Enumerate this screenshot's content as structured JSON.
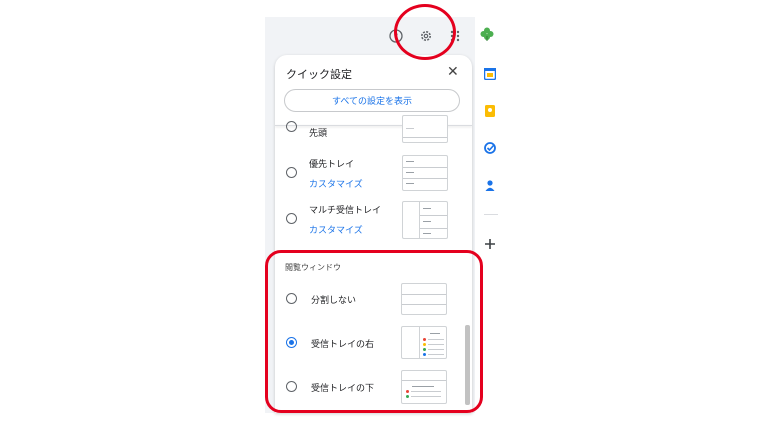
{
  "quick_settings": {
    "title": "クイック設定",
    "close_label": "✕",
    "all_settings_button": "すべての設定を表示"
  },
  "inbox_types": [
    {
      "label": "先頭",
      "selected": false
    },
    {
      "label": "優先トレイ",
      "link": "カスタマイズ",
      "selected": false
    },
    {
      "label": "マルチ受信トレイ",
      "link": "カスタマイズ",
      "selected": false
    }
  ],
  "reading_pane": {
    "heading": "閲覧ウィンドウ",
    "options": [
      {
        "label": "分割しない",
        "selected": false
      },
      {
        "label": "受信トレイの右",
        "selected": true
      },
      {
        "label": "受信トレイの下",
        "selected": false
      }
    ]
  },
  "header_icons": [
    "help-icon",
    "settings-gear-icon",
    "apps-grid-icon",
    "clover-avatar-icon"
  ],
  "side_panel_icons": [
    "calendar-icon",
    "keep-icon",
    "tasks-icon",
    "contacts-icon",
    "add-icon"
  ],
  "colors": {
    "accent": "#1a73e8",
    "highlight": "#e4001e",
    "panel": "#f1f3f6"
  }
}
